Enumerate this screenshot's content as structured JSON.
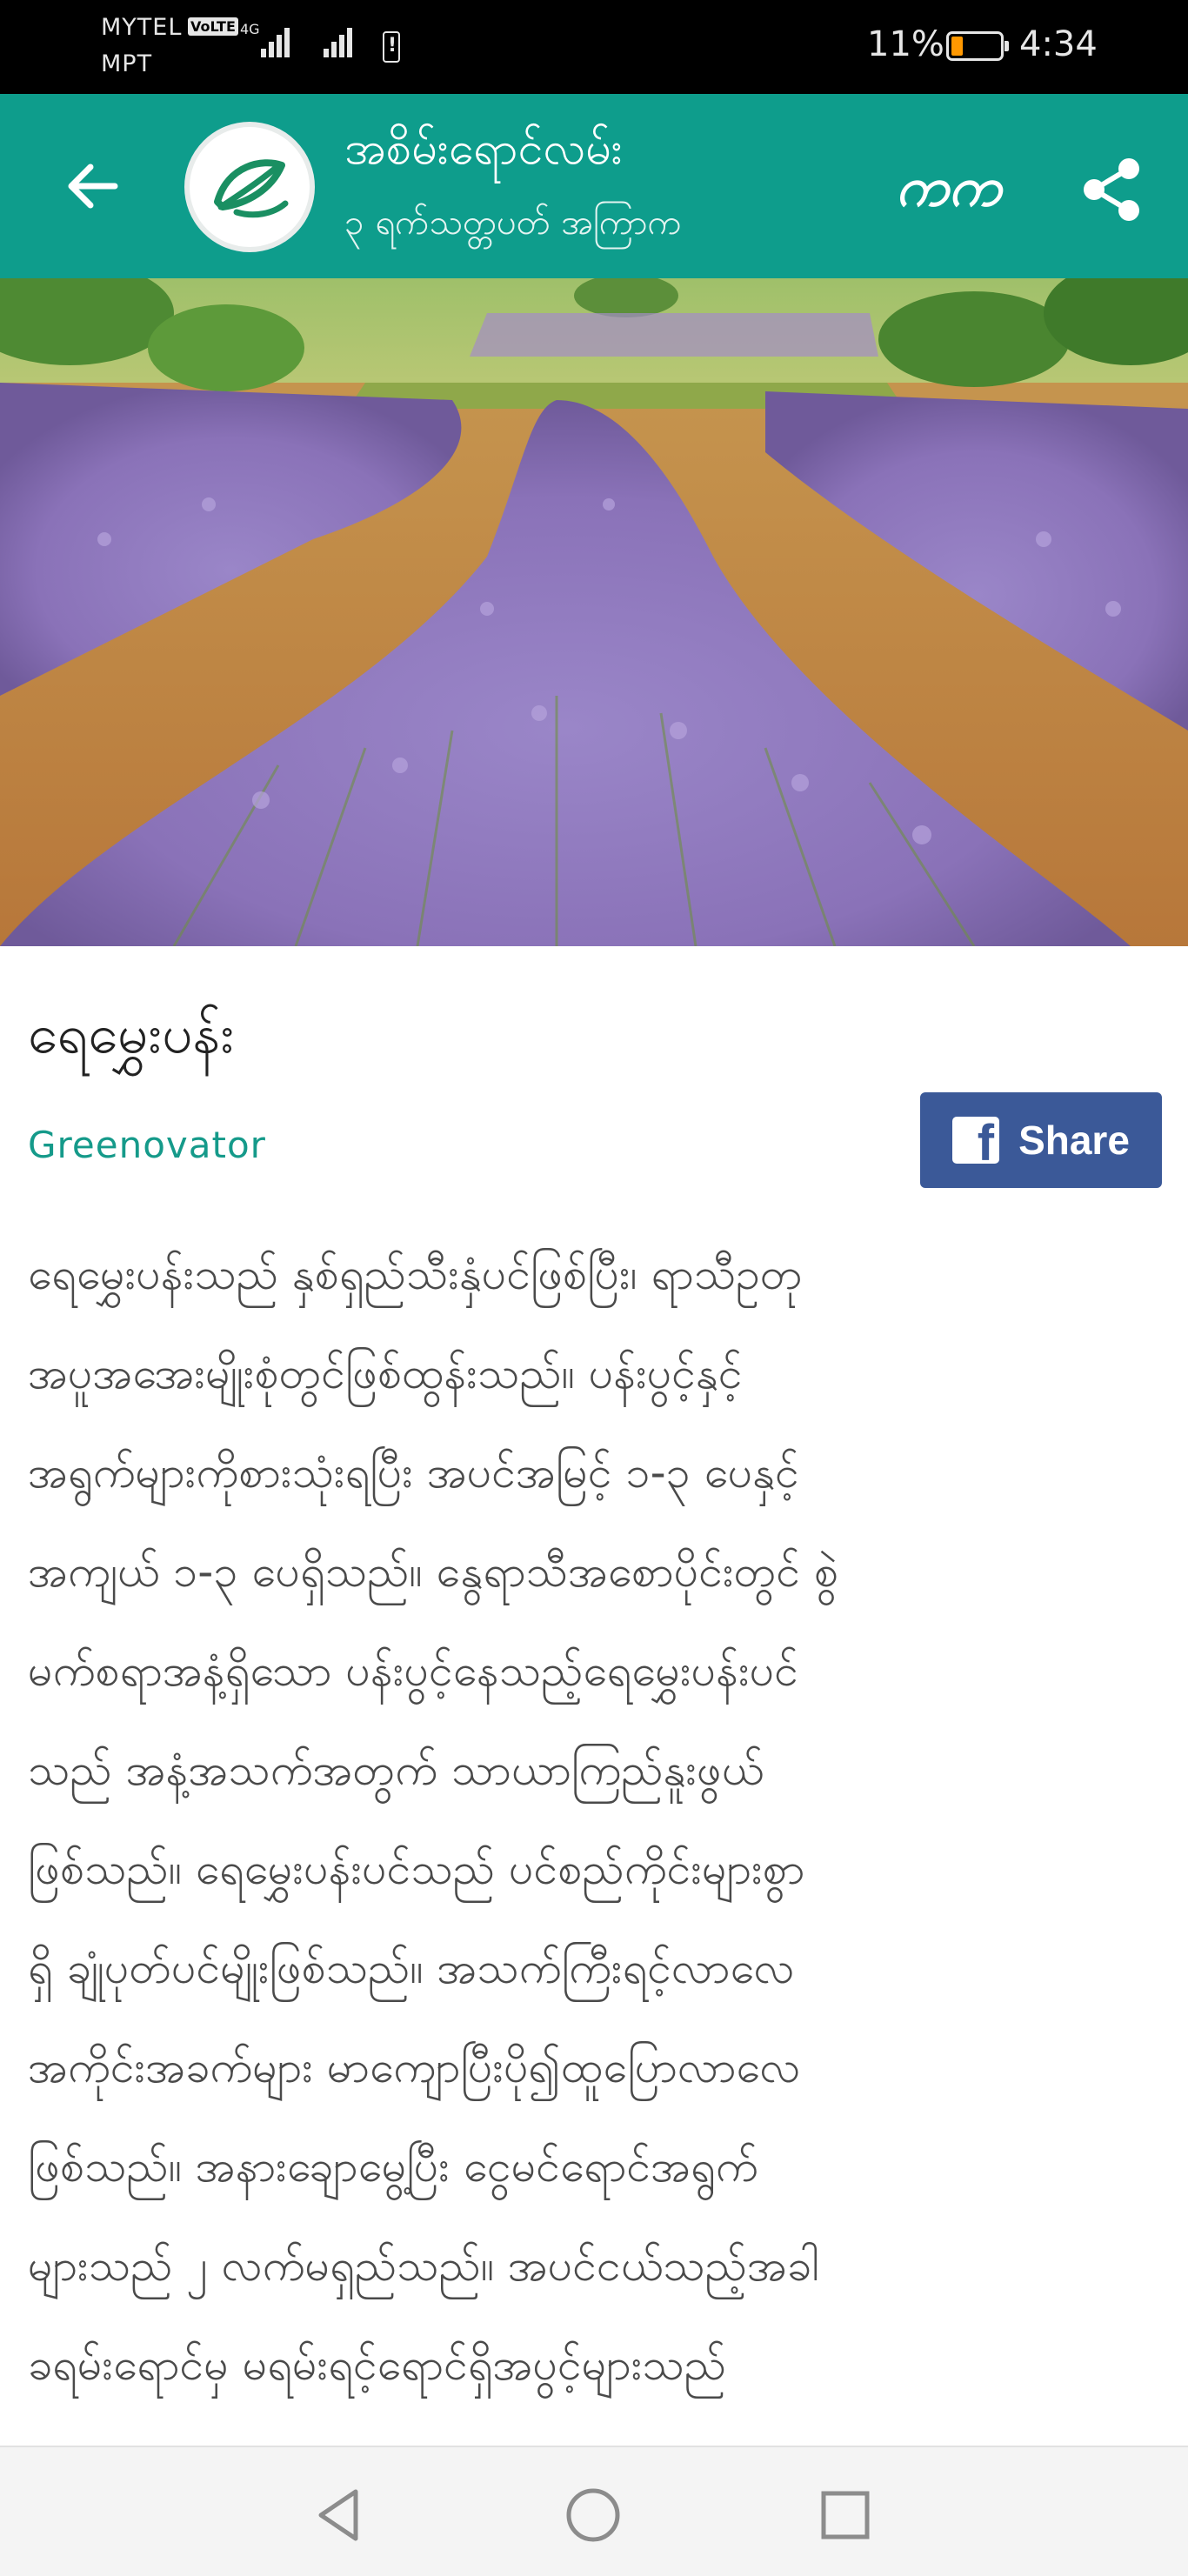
{
  "status_bar": {
    "carrier_1": "MYTEL",
    "volte_badge": "VoLTE",
    "network_type": "4G",
    "carrier_2": "MPT",
    "battery_percent": "11%",
    "battery_level": 0.11,
    "time": "4:34",
    "colors": {
      "background": "#000000",
      "battery_fill": "#ff9800"
    }
  },
  "app_bar": {
    "title": "အစိမ်းရောင်လမ်း",
    "subtitle": "၃ ရက်သတ္တပတ် အကြာက",
    "font_toggle_label": "ကက",
    "icons": {
      "back": "arrow-left-icon",
      "logo": "leaf-logo-icon",
      "share": "share-icon"
    },
    "colors": {
      "background": "#0e9d8c"
    }
  },
  "hero_image": {
    "description_icon": "lavender-field-photo"
  },
  "article": {
    "title": "ရေမွှေးပန်း",
    "author": "Greenovator",
    "facebook_share_label": "Share",
    "colors": {
      "author": "#159a8a",
      "facebook": "#3b5998"
    },
    "body_lines": [
      "ရေမွှေးပန်းသည် နှစ်ရှည်သီးနှံပင်ဖြစ်ပြီး၊ ရာသီဥတု",
      "အပူအအေးမျိုးစုံတွင်ဖြစ်ထွန်းသည်။ ပန်းပွင့်နှင့်",
      "အရွက်များကိုစားသုံးရပြီး အပင်အမြင့် ၁-၃ ပေနှင့်",
      "အကျယ် ၁-၃ ပေရှိသည်။ နွေရာသီအစောပိုင်းတွင် စွဲ",
      "မက်စရာအနံ့ရှိသော ပန်းပွင့်နေသည့်ရေမွှေးပန်းပင်",
      "သည် အနံ့အသက်အတွက် သာယာကြည်နူးဖွယ်",
      "ဖြစ်သည်။ ရေမွှေးပန်းပင်သည် ပင်စည်ကိုင်းများစွာ",
      "ရှိ ချုံပုတ်ပင်မျိုးဖြစ်သည်။ အသက်ကြီးရင့်လာလေ",
      "အကိုင်းအခက်များ မာကျောပြီးပို၍ထူပြောလာလေ",
      "ဖြစ်သည်။ အနားချောမွေ့ပြီး ငွေမင်ရောင်အရွက်",
      "များသည် ၂ လက်မရှည်သည်။ အပင်ငယ်သည့်အခါ",
      "ခရမ်းရောင်မှ မရမ်းရင့်ရောင်ရှိအပွင့်များသည်"
    ]
  },
  "nav_bar": {
    "icons": {
      "back": "triangle-back-icon",
      "home": "circle-home-icon",
      "recents": "square-recents-icon"
    }
  }
}
